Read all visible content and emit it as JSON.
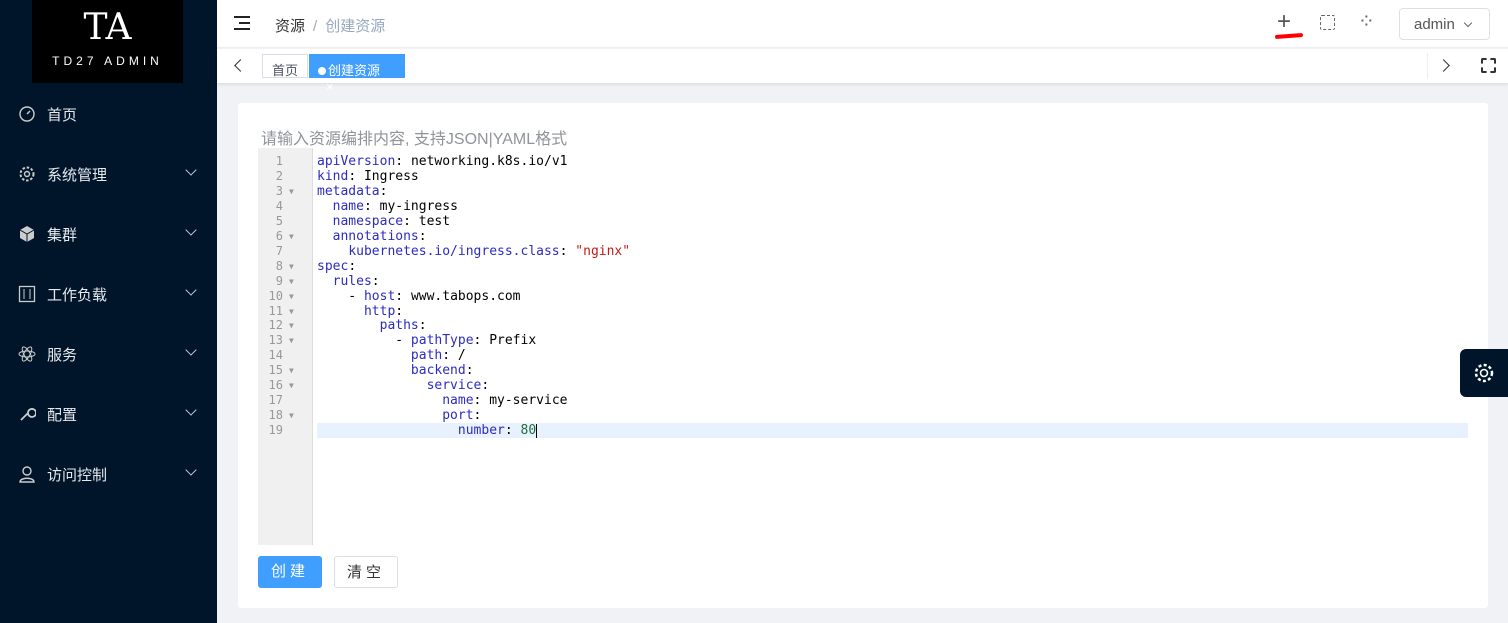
{
  "logo": {
    "big": "TA",
    "small": "TD27 ADMIN"
  },
  "sidebar": {
    "items": [
      {
        "label": "首页",
        "icon": "dashboard-icon",
        "expandable": false
      },
      {
        "label": "系统管理",
        "icon": "gear-icon",
        "expandable": true
      },
      {
        "label": "集群",
        "icon": "cube-icon",
        "expandable": true
      },
      {
        "label": "工作负载",
        "icon": "sliders-icon",
        "expandable": true
      },
      {
        "label": "服务",
        "icon": "atom-icon",
        "expandable": true
      },
      {
        "label": "配置",
        "icon": "wrench-icon",
        "expandable": true
      },
      {
        "label": "访问控制",
        "icon": "user-icon",
        "expandable": true
      }
    ]
  },
  "header": {
    "breadcrumb": [
      "资源",
      "创建资源"
    ],
    "separator": "/",
    "user": "admin"
  },
  "tabs": {
    "items": [
      {
        "label": "首页"
      },
      {
        "label": "创建资源"
      }
    ]
  },
  "editor": {
    "placeholder": "请输入资源编排内容, 支持JSON|YAML格式",
    "lines": [
      {
        "n": "1",
        "fold": false,
        "indent": "",
        "key": "apiVersion",
        "value": "networking.k8s.io/v1",
        "vt": "plain"
      },
      {
        "n": "2",
        "fold": false,
        "indent": "",
        "key": "kind",
        "value": "Ingress",
        "vt": "plain"
      },
      {
        "n": "3",
        "fold": true,
        "indent": "",
        "key": "metadata",
        "value": "",
        "vt": "plain"
      },
      {
        "n": "4",
        "fold": false,
        "indent": "  ",
        "key": "name",
        "value": "my-ingress",
        "vt": "plain"
      },
      {
        "n": "5",
        "fold": false,
        "indent": "  ",
        "key": "namespace",
        "value": "test",
        "vt": "plain"
      },
      {
        "n": "6",
        "fold": true,
        "indent": "  ",
        "key": "annotations",
        "value": "",
        "vt": "plain"
      },
      {
        "n": "7",
        "fold": false,
        "indent": "    ",
        "key": "kubernetes.io/ingress.class",
        "value": "\"nginx\"",
        "vt": "s"
      },
      {
        "n": "8",
        "fold": true,
        "indent": "",
        "key": "spec",
        "value": "",
        "vt": "plain"
      },
      {
        "n": "9",
        "fold": true,
        "indent": "  ",
        "key": "rules",
        "value": "",
        "vt": "plain"
      },
      {
        "n": "10",
        "fold": true,
        "indent": "    - ",
        "key": "host",
        "value": "www.tabops.com",
        "vt": "plain"
      },
      {
        "n": "11",
        "fold": true,
        "indent": "      ",
        "key": "http",
        "value": "",
        "vt": "plain"
      },
      {
        "n": "12",
        "fold": true,
        "indent": "        ",
        "key": "paths",
        "value": "",
        "vt": "plain"
      },
      {
        "n": "13",
        "fold": true,
        "indent": "          - ",
        "key": "pathType",
        "value": "Prefix",
        "vt": "plain"
      },
      {
        "n": "14",
        "fold": false,
        "indent": "            ",
        "key": "path",
        "value": "/",
        "vt": "plain"
      },
      {
        "n": "15",
        "fold": true,
        "indent": "            ",
        "key": "backend",
        "value": "",
        "vt": "plain"
      },
      {
        "n": "16",
        "fold": true,
        "indent": "              ",
        "key": "service",
        "value": "",
        "vt": "plain"
      },
      {
        "n": "17",
        "fold": false,
        "indent": "                ",
        "key": "name",
        "value": "my-service",
        "vt": "plain"
      },
      {
        "n": "18",
        "fold": true,
        "indent": "                ",
        "key": "port",
        "value": "",
        "vt": "plain"
      },
      {
        "n": "19",
        "fold": false,
        "indent": "                  ",
        "key": "number",
        "value": "80",
        "vt": "num"
      }
    ]
  },
  "actions": {
    "create": "创建",
    "clear": "清空"
  }
}
